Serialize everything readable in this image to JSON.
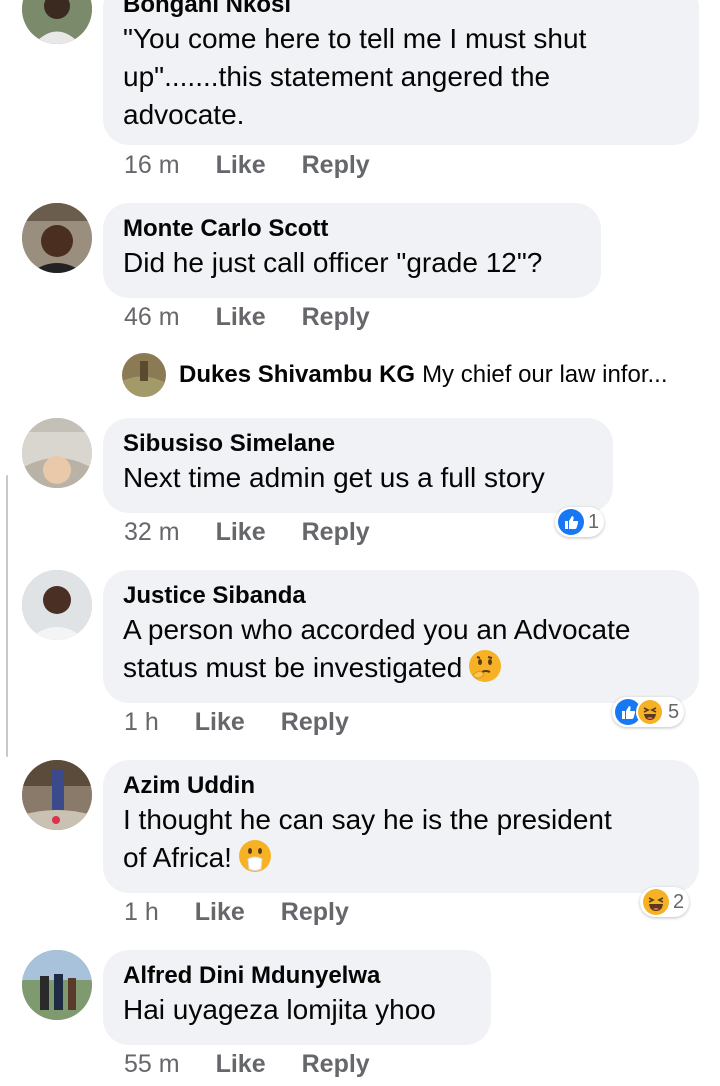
{
  "comments": [
    {
      "author": "Bongani Nkosi",
      "text_lines": [
        "\"You come here to tell me I must shut",
        "up\".......this statement angered the",
        "advocate."
      ],
      "time": "16 m",
      "like_label": "Like",
      "reply_label": "Reply"
    },
    {
      "author": "Monte Carlo Scott",
      "text_lines": [
        "Did he just call officer \"grade 12\"?"
      ],
      "time": "46 m",
      "like_label": "Like",
      "reply_label": "Reply",
      "reply_preview": {
        "author": "Dukes Shivambu KG",
        "text": "My chief our law infor..."
      }
    },
    {
      "author": "Sibusiso Simelane",
      "text_lines": [
        "Next time admin get us a full story"
      ],
      "time": "32 m",
      "like_label": "Like",
      "reply_label": "Reply",
      "reactions": {
        "icons": [
          "like-icon"
        ],
        "count": "1"
      }
    },
    {
      "author": "Justice Sibanda",
      "text_lines": [
        "A person who accorded you an Advocate",
        "status must be investigated"
      ],
      "emoji": "thinking-face-icon",
      "time": "1 h",
      "like_label": "Like",
      "reply_label": "Reply",
      "reactions": {
        "icons": [
          "like-icon",
          "haha-icon"
        ],
        "count": "5"
      }
    },
    {
      "author": "Azim Uddin",
      "text_lines": [
        "I thought he can say he is the president",
        "of Africa!"
      ],
      "emoji": "hand-over-mouth-icon",
      "time": "1 h",
      "like_label": "Like",
      "reply_label": "Reply",
      "reactions": {
        "icons": [
          "haha-icon"
        ],
        "count": "2"
      }
    },
    {
      "author": "Alfred Dini Mdunyelwa",
      "text_lines": [
        "Hai uyageza lomjita yhoo"
      ],
      "time": "55 m",
      "like_label": "Like",
      "reply_label": "Reply"
    }
  ],
  "colors": {
    "bubble": "#f0f2f5",
    "secondary_text": "#65676b",
    "like_blue": "#1877f2",
    "haha_yellow": "#f7b125"
  }
}
